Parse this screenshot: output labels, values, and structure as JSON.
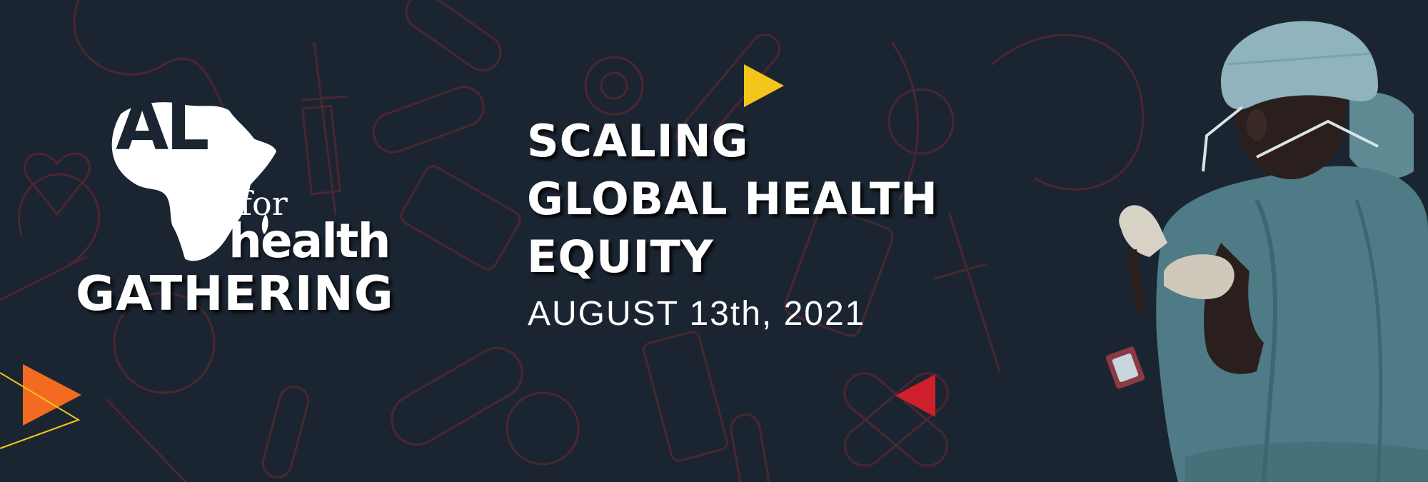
{
  "logo": {
    "al": "AL",
    "for": "for",
    "health": "health",
    "gathering": "GATHERING"
  },
  "headline": {
    "line1": "SCALING",
    "line2": "GLOBAL HEALTH",
    "line3": "EQUITY"
  },
  "date": "AUGUST 13th, 2021",
  "colors": {
    "background": "#1b2532",
    "pattern": "#4a2730",
    "accent_yellow": "#f4c51b",
    "accent_orange": "#f26b21",
    "accent_red": "#d01f2c",
    "text": "#ffffff"
  },
  "icons": [
    "africa-map-icon",
    "play-triangle-yellow-icon",
    "play-triangle-orange-icon",
    "play-triangle-red-icon",
    "medical-doodle-pattern"
  ]
}
